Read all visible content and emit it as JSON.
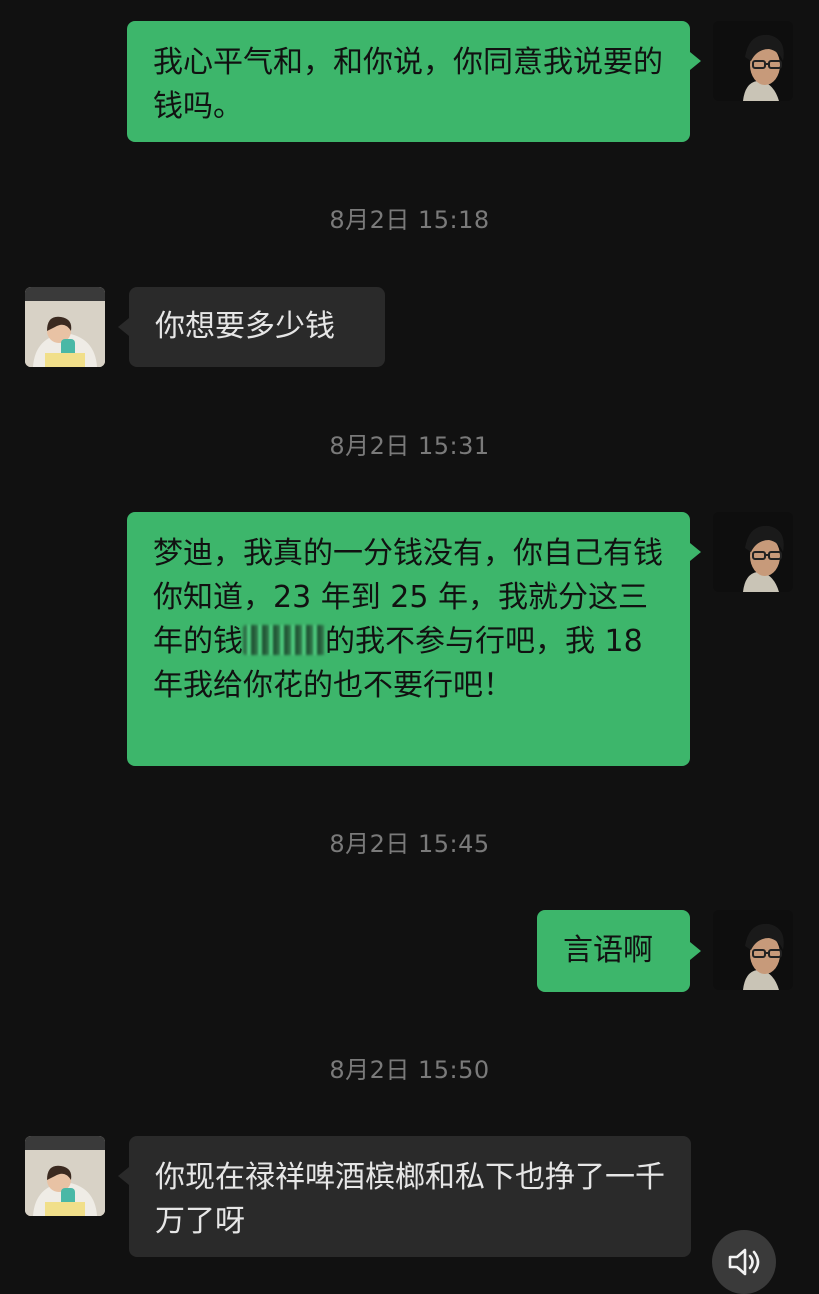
{
  "messages": [
    {
      "side": "out",
      "text": "我心平气和，和你说，你同意我说要的钱吗。"
    },
    {
      "timestamp": "8月2日 15:18"
    },
    {
      "side": "in",
      "text": "你想要多少钱"
    },
    {
      "timestamp": "8月2日 15:31"
    },
    {
      "side": "out",
      "text_before": "梦迪，我真的一分钱没有，你自己有钱你知道，23 年到 25 年，我就分这三年的钱",
      "text_after": "的我不参与行吧，我 18 年我给你花的也不要行吧！"
    },
    {
      "timestamp": "8月2日 15:45"
    },
    {
      "side": "out",
      "text": "言语啊"
    },
    {
      "timestamp": "8月2日 15:50"
    },
    {
      "side": "in",
      "text": "你现在禄祥啤酒槟榔和私下也挣了一千万了呀"
    }
  ],
  "colors": {
    "background": "#111111",
    "outgoing_bubble": "#3db66b",
    "incoming_bubble": "#2a2a2a",
    "timestamp": "#7a7a7a"
  },
  "icons": {
    "sound": "speaker-icon"
  }
}
